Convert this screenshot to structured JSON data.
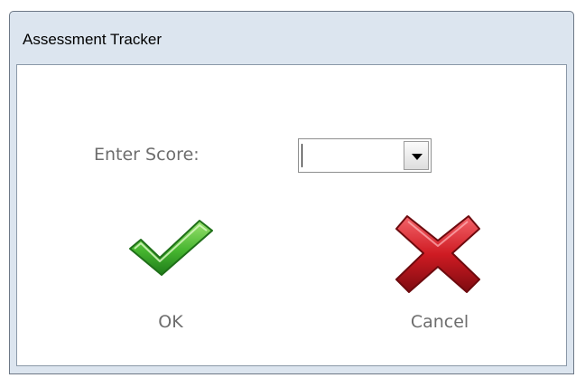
{
  "window": {
    "title": "Assessment Tracker"
  },
  "form": {
    "score_label": "Enter Score:",
    "score_value": ""
  },
  "actions": {
    "ok_label": "OK",
    "cancel_label": "Cancel"
  },
  "icons": {
    "ok": "green-checkmark-icon",
    "cancel": "red-x-icon",
    "dropdown": "chevron-down-icon"
  },
  "colors": {
    "titlebar": "#dce5ef",
    "label_text": "#6d6d6d",
    "ok_green": "#44b233",
    "cancel_red": "#c8141a"
  }
}
